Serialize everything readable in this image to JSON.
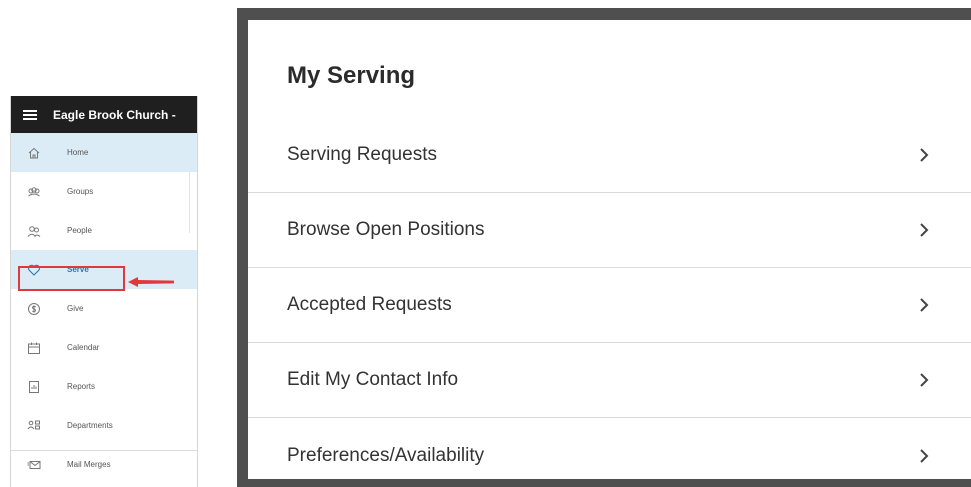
{
  "sidebar": {
    "org_name": "Eagle Brook Church -",
    "items": [
      {
        "label": "Home",
        "icon": "home-icon"
      },
      {
        "label": "Groups",
        "icon": "groups-icon"
      },
      {
        "label": "People",
        "icon": "people-icon"
      },
      {
        "label": "Serve",
        "icon": "heart-icon"
      },
      {
        "label": "Give",
        "icon": "dollar-icon"
      },
      {
        "label": "Calendar",
        "icon": "calendar-icon"
      },
      {
        "label": "Reports",
        "icon": "reports-icon"
      },
      {
        "label": "Departments",
        "icon": "departments-icon"
      },
      {
        "label": "Mail Merges",
        "icon": "mail-icon"
      }
    ],
    "active_item": "Serve",
    "highlight_color": "#e0393c",
    "active_bg": "#dcecf7",
    "header_bg": "#1f1f1f"
  },
  "panel": {
    "title": "My Serving",
    "rows": [
      {
        "label": "Serving Requests"
      },
      {
        "label": "Browse Open Positions"
      },
      {
        "label": "Accepted Requests"
      },
      {
        "label": "Edit My Contact Info"
      },
      {
        "label": "Preferences/Availability"
      }
    ]
  }
}
